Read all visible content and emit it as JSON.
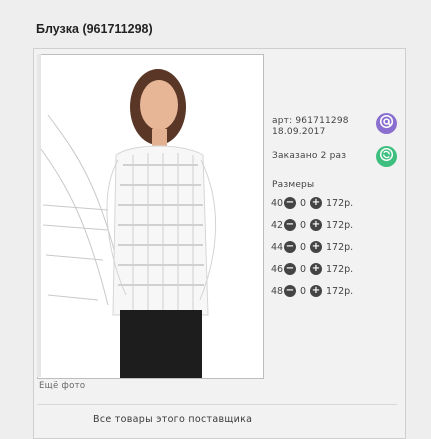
{
  "title": "Блузка (961711298)",
  "product": {
    "sku": "арт: 961711298",
    "date": "18.09.2017",
    "ordered": "Заказано 2 раз"
  },
  "sizes": {
    "heading": "Размеры",
    "rows": [
      {
        "size": "40",
        "qty": "0",
        "price": "172р."
      },
      {
        "size": "42",
        "qty": "0",
        "price": "172р."
      },
      {
        "size": "44",
        "qty": "0",
        "price": "172р."
      },
      {
        "size": "46",
        "qty": "0",
        "price": "172р."
      },
      {
        "size": "48",
        "qty": "0",
        "price": "172р."
      }
    ]
  },
  "more_photo": "Ещё фото",
  "all_items_link": "Все товары этого поставщика",
  "colors": {
    "purple": "#8b6fd0",
    "green": "#3fbf7f"
  },
  "icons": {
    "purple_button": "at-symbol-icon",
    "green_button": "refresh-icon",
    "minus": "minus-icon",
    "plus": "plus-icon"
  }
}
